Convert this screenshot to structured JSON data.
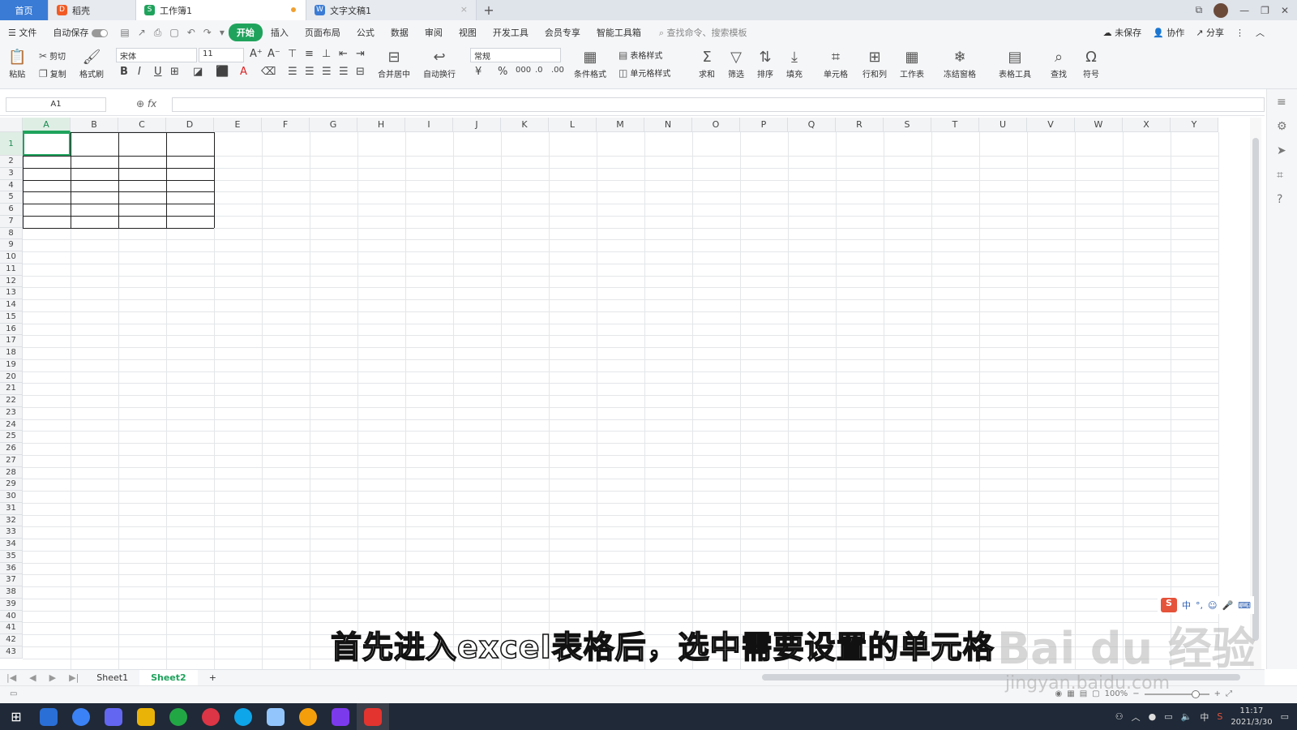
{
  "tabs": {
    "home": "首页",
    "t1": "稻壳",
    "t2": "工作簿1",
    "t3": "文字文稿1",
    "plus": "+"
  },
  "menu": {
    "file": "文件",
    "autosave": "自动保存",
    "items": [
      "开始",
      "插入",
      "页面布局",
      "公式",
      "数据",
      "审阅",
      "视图",
      "开发工具",
      "会员专享",
      "智能工具箱"
    ],
    "search": "查找命令、搜索模板",
    "unsaved": "未保存",
    "collab": "协作",
    "share": "分享"
  },
  "ribbon": {
    "paste": "粘贴",
    "cut": "剪切",
    "copy": "复制",
    "format_painter": "格式刷",
    "font": "宋体",
    "size": "11",
    "merge": "合并居中",
    "wrap": "自动换行",
    "numfmt": "常规",
    "table_style": "表格样式",
    "cond_fmt": "条件格式",
    "cell_style": "单元格样式",
    "sum": "求和",
    "filter": "筛选",
    "sort": "排序",
    "fill": "填充",
    "cell": "单元格",
    "rowcol": "行和列",
    "sheet": "工作表",
    "freeze": "冻结窗格",
    "tabletools": "表格工具",
    "find": "查找",
    "symbol": "符号"
  },
  "formula": {
    "namebox": "A1",
    "fx": "fx"
  },
  "columns": [
    "A",
    "B",
    "C",
    "D",
    "E",
    "F",
    "G",
    "H",
    "I",
    "J",
    "K",
    "L",
    "M",
    "N",
    "O",
    "P",
    "Q",
    "R",
    "S",
    "T",
    "U",
    "V",
    "W",
    "X",
    "Y"
  ],
  "rows": [
    "1",
    "2",
    "3",
    "4",
    "5",
    "6",
    "7",
    "8",
    "9",
    "10",
    "11",
    "12",
    "13",
    "14",
    "15",
    "16",
    "17",
    "18",
    "19",
    "20",
    "21",
    "22",
    "23",
    "24",
    "25",
    "26",
    "27",
    "28",
    "29",
    "30",
    "31",
    "32",
    "33",
    "34",
    "35",
    "36",
    "37",
    "38",
    "39",
    "40",
    "41",
    "42",
    "43"
  ],
  "sheets": {
    "s1": "Sheet1",
    "s2": "Sheet2",
    "add": "+"
  },
  "status": {
    "zoom": "100%"
  },
  "subtitle": "首先进入excel表格后，选中需要设置的单元格",
  "watermark": {
    "main": "Bai  du 经验",
    "url": "jingyan.baidu.com"
  },
  "ime": [
    "中",
    "°,",
    "☺",
    "🎤",
    "⌨"
  ],
  "clock": {
    "time": "11:17",
    "date": "2021/3/30"
  },
  "tray": {
    "lang": "中"
  },
  "colors": {
    "accent": "#1fa35c",
    "tabblue": "#3a7bd5"
  }
}
